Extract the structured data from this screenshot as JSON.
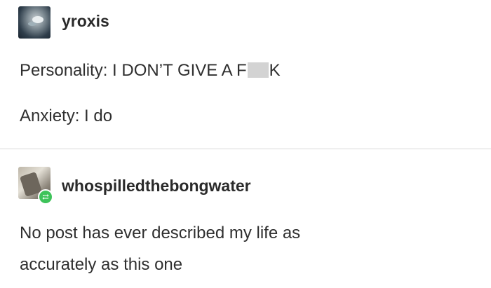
{
  "posts": [
    {
      "username": "yroxis",
      "avatar_icon": "user-avatar-icon",
      "lines": {
        "personality_prefix": "Personality: I DON’T GIVE A F",
        "personality_suffix": "K",
        "anxiety": "Anxiety: I do"
      }
    },
    {
      "username": "whospilledthebongwater",
      "avatar_icon": "user-avatar-icon",
      "badge_icon": "reblog-icon",
      "badge_color": "#3ec35a",
      "lines": {
        "first": "No post has ever described my life as",
        "second": "accurately as this one"
      }
    }
  ]
}
